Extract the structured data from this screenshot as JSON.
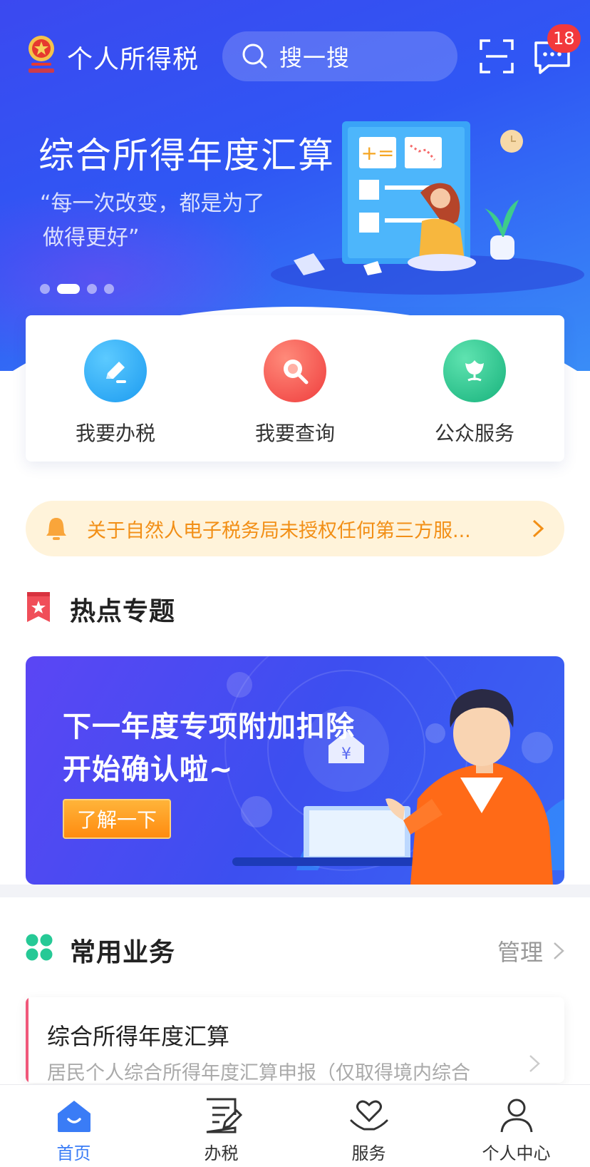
{
  "header": {
    "app_title": "个人所得税",
    "search_placeholder": "搜一搜",
    "message_badge": "18"
  },
  "hero": {
    "title": "综合所得年度汇算",
    "quote_line1": "“每一次改变，都是为了",
    "quote_line2": "做得更好”",
    "carousel_total": 4,
    "carousel_active_index": 1
  },
  "actions": [
    {
      "label": "我要办税",
      "icon": "pencil-icon",
      "color": "#22a6f5"
    },
    {
      "label": "我要查询",
      "icon": "magnifier-icon",
      "color": "#f5534e"
    },
    {
      "label": "公众服务",
      "icon": "tulip-icon",
      "color": "#23c48f"
    }
  ],
  "notice": {
    "text": "关于自然人电子税务局未授权任何第三方服..."
  },
  "hot_topics": {
    "title": "热点专题",
    "banner_line1": "下一年度专项附加扣除",
    "banner_line2": "开始确认啦~",
    "banner_button": "了解一下"
  },
  "common_business": {
    "title": "常用业务",
    "manage_label": "管理",
    "items": [
      {
        "title": "综合所得年度汇算",
        "desc": "居民个人综合所得年度汇算申报（仅取得境内综合"
      }
    ]
  },
  "tabbar": {
    "tabs": [
      {
        "label": "首页",
        "icon": "home-icon",
        "active": true
      },
      {
        "label": "办税",
        "icon": "document-edit-icon",
        "active": false
      },
      {
        "label": "服务",
        "icon": "heart-hand-icon",
        "active": false
      },
      {
        "label": "个人中心",
        "icon": "person-icon",
        "active": false
      }
    ]
  },
  "colors": {
    "brand_blue": "#3a7cf6",
    "notice_orange": "#f28f16",
    "badge_red": "#f2393c"
  }
}
